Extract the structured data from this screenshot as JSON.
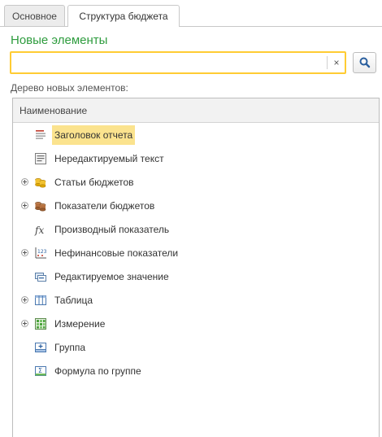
{
  "tabs": [
    {
      "label": "Основное",
      "active": false
    },
    {
      "label": "Структура бюджета",
      "active": true
    }
  ],
  "section_title": "Новые элементы",
  "search": {
    "value": "",
    "clear_symbol": "×"
  },
  "tree_label": "Дерево новых элементов:",
  "tree": {
    "column_header": "Наименование",
    "items": [
      {
        "label": "Заголовок отчета",
        "icon": "report-header-icon",
        "expandable": false,
        "selected": true
      },
      {
        "label": "Нередактируемый текст",
        "icon": "readonly-text-icon",
        "expandable": false,
        "selected": false
      },
      {
        "label": "Статьи бюджетов",
        "icon": "budget-items-icon",
        "expandable": true,
        "selected": false
      },
      {
        "label": "Показатели бюджетов",
        "icon": "budget-indicators-icon",
        "expandable": true,
        "selected": false
      },
      {
        "label": "Производный показатель",
        "icon": "function-icon",
        "expandable": false,
        "selected": false
      },
      {
        "label": "Нефинансовые показатели",
        "icon": "nonfinancial-icon",
        "expandable": true,
        "selected": false
      },
      {
        "label": "Редактируемое значение",
        "icon": "editable-value-icon",
        "expandable": false,
        "selected": false
      },
      {
        "label": "Таблица",
        "icon": "table-icon",
        "expandable": true,
        "selected": false
      },
      {
        "label": "Измерение",
        "icon": "dimension-icon",
        "expandable": true,
        "selected": false
      },
      {
        "label": "Группа",
        "icon": "group-icon",
        "expandable": false,
        "selected": false
      },
      {
        "label": "Формула по группе",
        "icon": "group-formula-icon",
        "expandable": false,
        "selected": false
      }
    ]
  },
  "colors": {
    "section_title": "#2e9c3e",
    "search_focus_border": "#ffcc33",
    "selection": "#fbe38e"
  }
}
